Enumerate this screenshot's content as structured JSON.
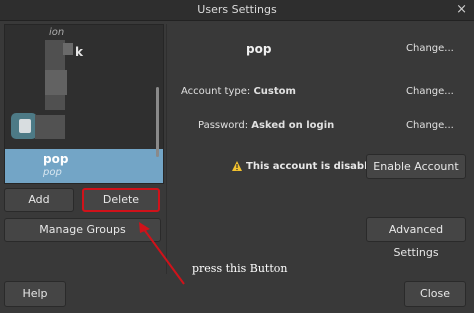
{
  "window": {
    "title": "Users Settings",
    "close_glyph": "×"
  },
  "sidebar": {
    "users": [
      {
        "name": "ion"
      },
      {
        "name": "k"
      },
      {
        "name": "pop",
        "subtitle": "pop"
      }
    ],
    "add_label": "Add",
    "delete_label": "Delete",
    "manage_groups_label": "Manage Groups"
  },
  "details": {
    "username": "pop",
    "change_label": "Change...",
    "account_type_label": "Account type:",
    "account_type_value": "Custom",
    "password_label": "Password:",
    "password_value": "Asked on login",
    "disabled_message": "This account is disabled.",
    "enable_account_label": "Enable Account",
    "advanced_settings_label": "Advanced Settings"
  },
  "footer": {
    "help_label": "Help",
    "close_label": "Close"
  },
  "annotation": {
    "text": "press this Button",
    "highlight_color": "#d0121a"
  },
  "colors": {
    "selected_row": "#73a5c6",
    "warning": "#f2c12e"
  }
}
